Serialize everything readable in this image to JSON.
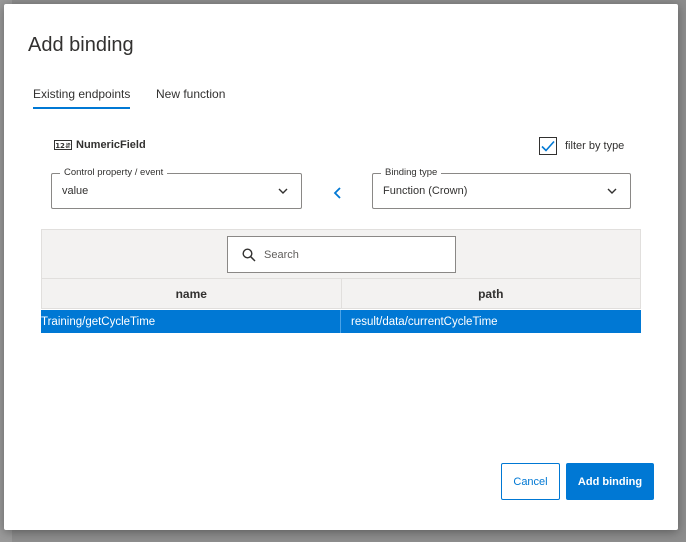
{
  "dialog": {
    "title": "Add binding"
  },
  "tabs": [
    {
      "label": "Existing endpoints",
      "active": true
    },
    {
      "label": "New function",
      "active": false
    }
  ],
  "control": {
    "icon": "numeric-field-icon",
    "icon_text": "12",
    "name": "NumericField"
  },
  "filter": {
    "label": "filter by type",
    "checked": true
  },
  "control_property": {
    "label": "Control property / event",
    "value": "value"
  },
  "binding_type": {
    "label": "Binding type",
    "value": "Function (Crown)"
  },
  "search": {
    "placeholder": "Search",
    "value": ""
  },
  "table": {
    "columns": [
      "name",
      "path"
    ],
    "rows": [
      {
        "name": "Training/getCycleTime",
        "path": "result/data/currentCycleTime",
        "selected": true
      }
    ]
  },
  "buttons": {
    "cancel": "Cancel",
    "add": "Add binding"
  },
  "colors": {
    "accent": "#0078d4",
    "text": "#323130",
    "header_bg": "#f3f2f1"
  }
}
